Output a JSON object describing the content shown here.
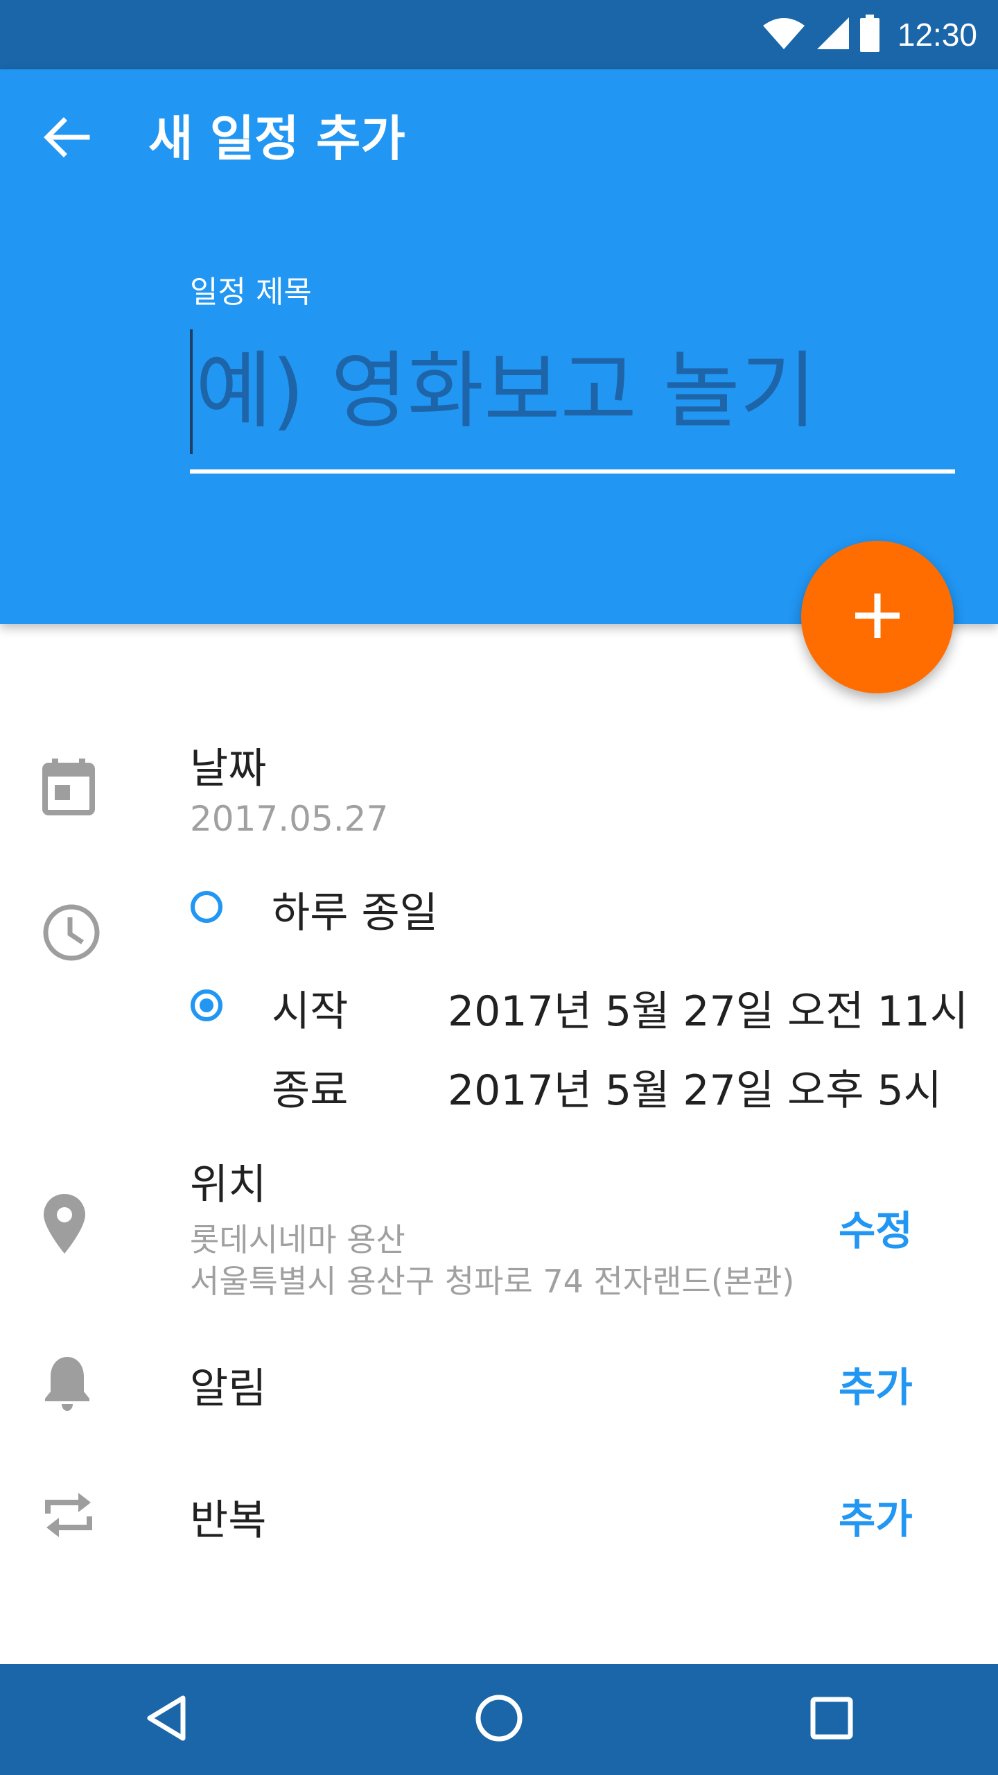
{
  "status_bar": {
    "time": "12:30",
    "icons": [
      "wifi-icon",
      "signal-icon",
      "battery-icon"
    ]
  },
  "header": {
    "title": "새 일정 추가",
    "back_icon": "arrow-back-icon"
  },
  "title_field": {
    "label": "일정 제목",
    "placeholder": "예) 영화보고 놀기",
    "value": ""
  },
  "fab": {
    "icon": "add-icon",
    "color": "#ff6d00"
  },
  "date": {
    "label": "날짜",
    "value": "2017.05.27",
    "icon": "calendar-icon"
  },
  "time": {
    "icon": "clock-icon",
    "all_day": {
      "label": "하루 종일",
      "selected": false
    },
    "start": {
      "label": "시작",
      "value": "2017년 5월 27일 오전 11시",
      "selected": true
    },
    "end": {
      "label": "종료",
      "value": "2017년 5월 27일 오후 5시"
    }
  },
  "location": {
    "label": "위치",
    "name": "롯데시네마 용산",
    "address": "서울특별시 용산구 청파로 74 전자랜드(본관)",
    "action": "수정",
    "icon": "location-pin-icon"
  },
  "alarm": {
    "label": "알림",
    "action": "추가",
    "icon": "bell-icon"
  },
  "repeat": {
    "label": "반복",
    "action": "추가",
    "icon": "repeat-icon"
  },
  "nav_bar": {
    "buttons": [
      "back-triangle-icon",
      "home-circle-icon",
      "recents-square-icon"
    ]
  },
  "colors": {
    "primary": "#2196f3",
    "primary_dark": "#1a66a8",
    "accent": "#ff6d00"
  }
}
